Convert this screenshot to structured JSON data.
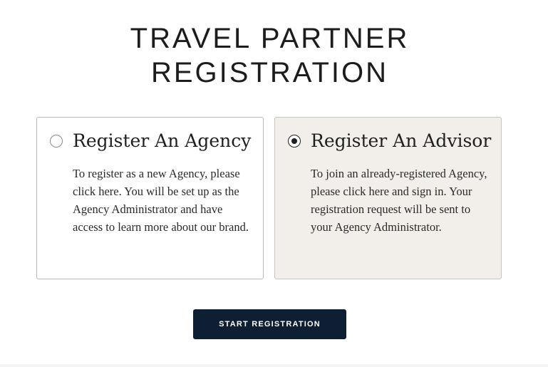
{
  "header": {
    "title_line1": "TRAVEL PARTNER",
    "title_line2": "REGISTRATION"
  },
  "options": {
    "agency": {
      "heading": "Register An Agency",
      "description": "To register as a new Agency, please click here. You will be set up as the Agency Administrator and have access to learn more about our brand.",
      "selected": false
    },
    "advisor": {
      "heading": "Register An Advisor",
      "description": "To join an already-registered Agency, please click here and sign in. Your registration request will be sent to your Agency Administrator.",
      "selected": true
    }
  },
  "actions": {
    "start_label": "START REGISTRATION"
  },
  "colors": {
    "button_background": "#0e1e33",
    "selected_card_background": "#f2efeb",
    "card_border": "#b9b9b9"
  }
}
